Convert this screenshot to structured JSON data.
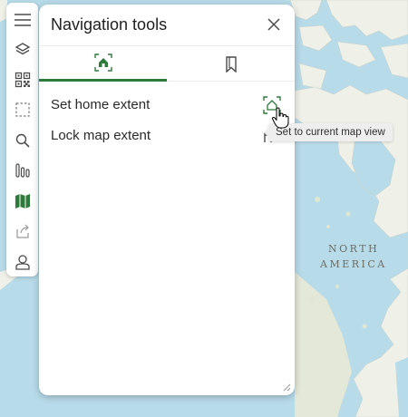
{
  "map": {
    "region_label_line1": "NORTH",
    "region_label_line2": "AMERICA",
    "colors": {
      "water": "#b8dbe9",
      "land": "#eff0e7",
      "land_dark": "#e2e5d6"
    }
  },
  "toolbar": {
    "items": [
      {
        "icon": "hamburger-menu-icon"
      },
      {
        "icon": "layers-icon"
      },
      {
        "icon": "qr-code-icon"
      },
      {
        "icon": "select-region-icon"
      },
      {
        "icon": "search-icon"
      },
      {
        "icon": "bar-chart-icon"
      },
      {
        "icon": "map-icon",
        "active": true
      },
      {
        "icon": "share-icon"
      },
      {
        "icon": "user-icon"
      }
    ]
  },
  "panel": {
    "title": "Navigation tools",
    "tabs": [
      {
        "icon": "home-extent-icon",
        "active": true
      },
      {
        "icon": "bookmark-icon",
        "active": false
      }
    ],
    "rows": [
      {
        "label": "Set home extent",
        "action_icon": "set-home-extent-icon"
      },
      {
        "label": "Lock map extent",
        "action_icon": "lock-icon"
      }
    ],
    "tooltip": "Set to current map view"
  },
  "colors": {
    "accent": "#2d7a3a",
    "icon": "#4a4a4a"
  }
}
